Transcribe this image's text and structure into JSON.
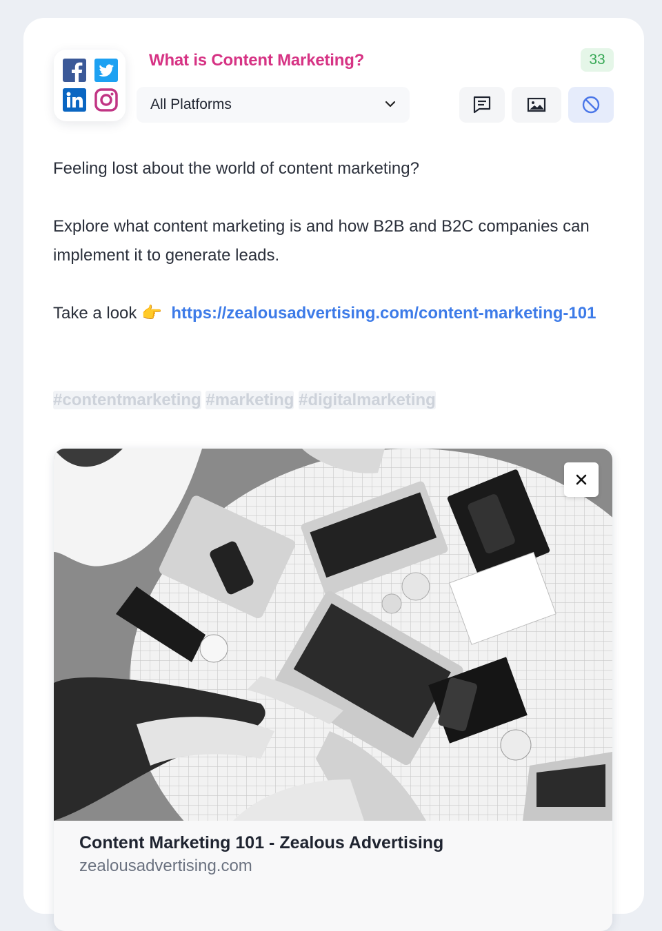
{
  "post": {
    "title": "What is Content Marketing?",
    "character_count": "33",
    "platform_select": {
      "selected": "All Platforms"
    },
    "platform_icons": [
      "facebook-icon",
      "twitter-icon",
      "linkedin-icon",
      "instagram-icon"
    ],
    "toolbar": {
      "comment_icon": "comment-icon",
      "image_icon": "image-icon",
      "disable_icon": "prohibited-icon"
    },
    "body": {
      "line1": "Feeling lost about the world of content marketing?",
      "line2": "Explore what content marketing is and how B2B and B2C companies can implement it to generate leads.",
      "line3_prefix": "Take a look ",
      "line3_emoji": "👉",
      "link": "https://zealousadvertising.com/content-marketing-101",
      "hashtags": [
        "#contentmarketing",
        "#marketing",
        "#digitalmarketing"
      ]
    },
    "link_preview": {
      "title": "Content Marketing 101 - Zealous Advertising",
      "domain": "zealousadvertising.com",
      "close_icon": "close-icon"
    }
  },
  "colors": {
    "title": "#d63384",
    "link": "#3d7be8",
    "badge_bg": "#e5f6e8",
    "badge_text": "#37a855",
    "facebook": "#3b5998",
    "twitter": "#1da1f2",
    "linkedin": "#0a66c2",
    "instagram": "#c13584"
  }
}
